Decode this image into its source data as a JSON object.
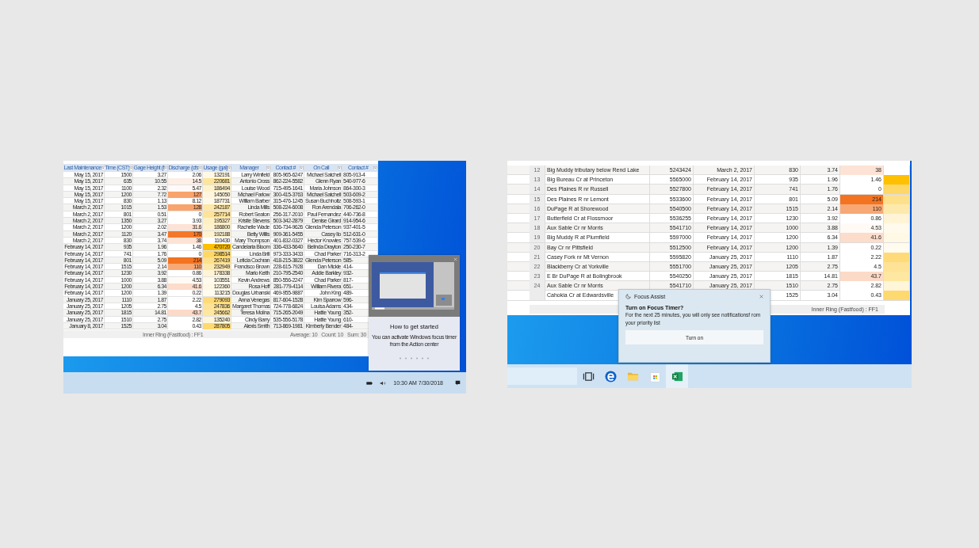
{
  "left_screen": {
    "left_table": {
      "columns": [
        "Last Maintenance",
        "Time (CST)",
        "Gage Height (f",
        "Discharge (cfs",
        "Usage (gal)",
        "Manager",
        "Contact #",
        "On Call",
        "Contact #"
      ],
      "rows": [
        {
          "date": "May 15, 2017",
          "time": "1500",
          "gage": "3.27",
          "discharge": {
            "text": "2.06",
            "color": "#ffffff"
          },
          "usage": {
            "text": "132191",
            "color": "#fff8e6"
          },
          "manager": "Larry Winfield",
          "contact": "805-965-6247",
          "on_call": "Michael Satchell",
          "contact_2": "805-913-4"
        },
        {
          "date": "May 15, 2017",
          "time": "635",
          "gage": "10.55",
          "discharge": {
            "text": "14.5",
            "color": "#fdeee6"
          },
          "usage": {
            "text": "220681",
            "color": "#fee59a"
          },
          "manager": "Antonio Cross",
          "contact": "862-224-5582",
          "on_call": "Glenn Ryan",
          "contact_2": "540-977-6"
        },
        {
          "date": "May 15, 2017",
          "time": "1100",
          "gage": "2.32",
          "discharge": {
            "text": "5.47",
            "color": "#fffaf7"
          },
          "usage": {
            "text": "186494",
            "color": "#fff2cc"
          },
          "manager": "Louise Wood",
          "contact": "715-495-1641",
          "on_call": "Maria Johnson",
          "contact_2": "864-300-3"
        },
        {
          "date": "May 15, 2017",
          "time": "1200",
          "gage": "7.72",
          "discharge": {
            "text": "127",
            "color": "#f8a46c"
          },
          "usage": {
            "text": "145050",
            "color": "#fff6dd"
          },
          "manager": "Michael Farlow",
          "contact": "300-415-3763",
          "on_call": "Michael Satchell",
          "contact_2": "503-609-2"
        },
        {
          "date": "May 15, 2017",
          "time": "830",
          "gage": "1.13",
          "discharge": {
            "text": "8.12",
            "color": "#ffffff"
          },
          "usage": {
            "text": "187731",
            "color": "#fff9ea"
          },
          "manager": "William Barber",
          "contact": "315-476-1245",
          "on_call": "Susan Buchholtz",
          "contact_2": "508-593-1"
        },
        {
          "date": "March 2, 2017",
          "time": "1015",
          "gage": "1.53",
          "discharge": {
            "text": "128",
            "color": "#f8a46c"
          },
          "usage": {
            "text": "242187",
            "color": "#fee8a6"
          },
          "manager": "Linda Mills",
          "contact": "508-224-6008",
          "on_call": "Ron Arendala",
          "contact_2": "706-262-0"
        },
        {
          "date": "March 2, 2017",
          "time": "801",
          "gage": "0.51",
          "discharge": {
            "text": "0",
            "color": "#ffffff"
          },
          "usage": {
            "text": "257714",
            "color": "#fee39a"
          },
          "manager": "Robert Seaton",
          "contact": "256-317-2010",
          "on_call": "Paul Fernandez",
          "contact_2": "440-736-8"
        },
        {
          "date": "March 2, 2017",
          "time": "1350",
          "gage": "3.27",
          "discharge": {
            "text": "3.93",
            "color": "#ffffff"
          },
          "usage": {
            "text": "195327",
            "color": "#fff0c4"
          },
          "manager": "Kristie Stevens",
          "contact": "503-342-2879",
          "on_call": "Denise Girard",
          "contact_2": "914-954-6"
        },
        {
          "date": "March 2, 2017",
          "time": "1200",
          "gage": "2.02",
          "discharge": {
            "text": "31.6",
            "color": "#fde3d5"
          },
          "usage": {
            "text": "186800",
            "color": "#fff2cc"
          },
          "manager": "Rachelle Wade",
          "contact": "636-734-9626",
          "on_call": "Glenda Peterson",
          "contact_2": "937-401-5"
        },
        {
          "date": "March 2, 2017",
          "time": "1120",
          "gage": "3.47",
          "discharge": {
            "text": "170",
            "color": "#f4782a"
          },
          "usage": {
            "text": "192188",
            "color": "#fff3d0"
          },
          "manager": "Betty Willis",
          "contact": "909-361-5455",
          "on_call": "Casey Ilo",
          "contact_2": "512-631-0"
        },
        {
          "date": "March 2, 2017",
          "time": "830",
          "gage": "3.74",
          "discharge": {
            "text": "38",
            "color": "#fde3d5"
          },
          "usage": {
            "text": "110430",
            "color": "#ffffff"
          },
          "manager": "Mary Thompson",
          "contact": "401-832-0327",
          "on_call": "Hector Knowles",
          "contact_2": "757-539-6"
        },
        {
          "date": "February 14, 2017",
          "time": "935",
          "gage": "1.96",
          "discharge": {
            "text": "1.46",
            "color": "#ffffff"
          },
          "usage": {
            "text": "470720",
            "color": "#fec000"
          },
          "manager": "Candelaria Bloom",
          "contact": "336-433-5640",
          "on_call": "Belinda Drayton",
          "contact_2": "250-230-7"
        },
        {
          "date": "February 14, 2017",
          "time": "741",
          "gage": "1.76",
          "discharge": {
            "text": "0",
            "color": "#ffffff"
          },
          "usage": {
            "text": "298514",
            "color": "#fed766"
          },
          "manager": "Linda Brill",
          "contact": "973-333-3433",
          "on_call": "Chad Parker",
          "contact_2": "716-313-2"
        },
        {
          "date": "February 14, 2017",
          "time": "801",
          "gage": "5.09",
          "discharge": {
            "text": "214",
            "color": "#f37320"
          },
          "usage": {
            "text": "267419",
            "color": "#fee08a"
          },
          "manager": "Leticia Cochran",
          "contact": "418-215-3822",
          "on_call": "Glenda Peterson",
          "contact_2": "585-"
        },
        {
          "date": "February 14, 2017",
          "time": "1515",
          "gage": "2.14",
          "discharge": {
            "text": "110",
            "color": "#f8a874"
          },
          "usage": {
            "text": "232949",
            "color": "#fee9ad"
          },
          "manager": "Francisco Brown",
          "contact": "228-615-7928",
          "on_call": "Dan Mickle",
          "contact_2": "414-"
        },
        {
          "date": "February 14, 2017",
          "time": "1230",
          "gage": "3.92",
          "discharge": {
            "text": "0.86",
            "color": "#ffffff"
          },
          "usage": {
            "text": "178338",
            "color": "#fff4d6"
          },
          "manager": "Mario Keith",
          "contact": "210-795-2540",
          "on_call": "Addie Barkley",
          "contact_2": "932-"
        },
        {
          "date": "February 14, 2017",
          "time": "1000",
          "gage": "3.88",
          "discharge": {
            "text": "4.53",
            "color": "#fffaf6"
          },
          "usage": {
            "text": "103551",
            "color": "#fffaeb"
          },
          "manager": "Kevin Andrews",
          "contact": "850-556-2247",
          "on_call": "Chad Parker",
          "contact_2": "817-"
        },
        {
          "date": "February 14, 2017",
          "time": "1200",
          "gage": "6.34",
          "discharge": {
            "text": "41.6",
            "color": "#fcdccb"
          },
          "usage": {
            "text": "122360",
            "color": "#fff8e5"
          },
          "manager": "Rosa Hoff",
          "contact": "281-779-4114",
          "on_call": "William Rivera",
          "contact_2": "651-"
        },
        {
          "date": "February 14, 2017",
          "time": "1200",
          "gage": "1.39",
          "discharge": {
            "text": "0.22",
            "color": "#ffffff"
          },
          "usage": {
            "text": "113215",
            "color": "#fffbee"
          },
          "manager": "Douglas Urbanski",
          "contact": "469-955-9887",
          "on_call": "John King",
          "contact_2": "489-"
        },
        {
          "date": "January 25, 2017",
          "time": "1110",
          "gage": "1.87",
          "discharge": {
            "text": "2.22",
            "color": "#ffffff"
          },
          "usage": {
            "text": "279093",
            "color": "#fedb78"
          },
          "manager": "Anna Venegas",
          "contact": "817-604-1528",
          "on_call": "Kim Sparrow",
          "contact_2": "596-"
        },
        {
          "date": "January 25, 2017",
          "time": "1205",
          "gage": "2.75",
          "discharge": {
            "text": "4.5",
            "color": "#ffffff"
          },
          "usage": {
            "text": "247836",
            "color": "#fee396"
          },
          "manager": "Margaret Thomas",
          "contact": "724-778-6824",
          "on_call": "Louisa Adams",
          "contact_2": "434-"
        },
        {
          "date": "January 25, 2017",
          "time": "1815",
          "gage": "14.81",
          "discharge": {
            "text": "43.7",
            "color": "#fcdac8"
          },
          "usage": {
            "text": "245662",
            "color": "#fee7a0"
          },
          "manager": "Teresa Molina",
          "contact": "715-265-2049",
          "on_call": "Hattie Young",
          "contact_2": "352-"
        },
        {
          "date": "January 25, 2017",
          "time": "1510",
          "gage": "2.75",
          "discharge": {
            "text": "2.82",
            "color": "#ffffff"
          },
          "usage": {
            "text": "135240",
            "color": "#fff5d8"
          },
          "manager": "Cindy Barry",
          "contact": "535-556-5178",
          "on_call": "Hattie Young",
          "contact_2": "610-"
        },
        {
          "date": "January 8, 2017",
          "time": "1525",
          "gage": "3.04",
          "discharge": {
            "text": "0.43",
            "color": "#ffffff"
          },
          "usage": {
            "text": "287805",
            "color": "#fed96f"
          },
          "manager": "Alexis Smith",
          "contact": "713-869-1981",
          "on_call": "Kimberly Bender",
          "contact_2": "484-"
        }
      ]
    },
    "status_bar": {
      "title": "Inner Ring (Fastfood) : FF1",
      "average": "Average: 10",
      "count": "Count: 10",
      "sum": "Sum: 30"
    },
    "tip_popup": {
      "title": "How to get started",
      "body": "You can activate Windows focus timer from the Action center"
    },
    "clock": "10:30 AM 7/30/2018"
  },
  "right_screen": {
    "right_table": {
      "rows": [
        {
          "number": "12",
          "name": "Big Muddy tributary below Rend Lake",
          "site": "5243424",
          "date": "March 2, 2017",
          "time": "830",
          "gage": "3.74",
          "discharge": {
            "text": "38",
            "color": "#fde3d5"
          },
          "usage": {
            "color": "#ffffff"
          }
        },
        {
          "number": "13",
          "name": "Big Bureau Cr at Princeton",
          "site": "5565000",
          "date": "February 14, 2017",
          "time": "935",
          "gage": "1.96",
          "discharge": {
            "text": "1.46",
            "color": "#ffffff"
          },
          "usage": {
            "color": "#fec000"
          }
        },
        {
          "number": "14",
          "name": "Des Plaines R nr Russell",
          "site": "5527800",
          "date": "February 14, 2017",
          "time": "741",
          "gage": "1.76",
          "discharge": {
            "text": "0",
            "color": "#ffffff"
          },
          "usage": {
            "color": "#fed766"
          }
        },
        {
          "number": "15",
          "name": "Des Plaines R nr Lemont",
          "site": "5533600",
          "date": "February 14, 2017",
          "time": "801",
          "gage": "5.09",
          "discharge": {
            "text": "214",
            "color": "#f37320"
          },
          "usage": {
            "color": "#fee08a"
          }
        },
        {
          "number": "16",
          "name": "DuPage R at Shorewood",
          "site": "5540500",
          "date": "February 14, 2017",
          "time": "1515",
          "gage": "2.14",
          "discharge": {
            "text": "110",
            "color": "#f8a874"
          },
          "usage": {
            "color": "#fee9ad"
          }
        },
        {
          "number": "17",
          "name": "Butterfield Cr at Flossmoor",
          "site": "5536255",
          "date": "February 14, 2017",
          "time": "1230",
          "gage": "3.92",
          "discharge": {
            "text": "0.86",
            "color": "#ffffff"
          },
          "usage": {
            "color": "#fff4d6"
          }
        },
        {
          "number": "18",
          "name": "Aux Sable Cr nr Morris",
          "site": "5541710",
          "date": "February 14, 2017",
          "time": "1000",
          "gage": "3.88",
          "discharge": {
            "text": "4.53",
            "color": "#fffaf6"
          },
          "usage": {
            "color": "#fffaeb"
          }
        },
        {
          "number": "19",
          "name": "Big Muddy R at Plumfield",
          "site": "5597000",
          "date": "February 14, 2017",
          "time": "1200",
          "gage": "6.34",
          "discharge": {
            "text": "41.6",
            "color": "#fcdccb"
          },
          "usage": {
            "color": "#fff8e5"
          }
        },
        {
          "number": "20",
          "name": "Bay Cr nr Pittsfield",
          "site": "5512500",
          "date": "February 14, 2017",
          "time": "1200",
          "gage": "1.39",
          "discharge": {
            "text": "0.22",
            "color": "#ffffff"
          },
          "usage": {
            "color": "#fffbee"
          }
        },
        {
          "number": "21",
          "name": "Casey Fork nr Mt Vernon",
          "site": "5595820",
          "date": "January 25, 2017",
          "time": "1110",
          "gage": "1.87",
          "discharge": {
            "text": "2.22",
            "color": "#ffffff"
          },
          "usage": {
            "color": "#fedb78"
          }
        },
        {
          "number": "22",
          "name": "Blackberry Cr at Yorkville",
          "site": "5551700",
          "date": "January 25, 2017",
          "time": "1205",
          "gage": "2.75",
          "discharge": {
            "text": "4.5",
            "color": "#ffffff"
          },
          "usage": {
            "color": "#fee396"
          }
        },
        {
          "number": "23",
          "name": "E Br DuPage R at Bolingbrook",
          "site": "5540250",
          "date": "January 25, 2017",
          "time": "1815",
          "gage": "14.81",
          "discharge": {
            "text": "43.7",
            "color": "#fcdac8"
          },
          "usage": {
            "color": "#fee7a0"
          }
        },
        {
          "number": "24",
          "name": "Aux Sable Cr nr Morris",
          "site": "5541710",
          "date": "January 25, 2017",
          "time": "1510",
          "gage": "2.75",
          "discharge": {
            "text": "2.82",
            "color": "#ffffff"
          },
          "usage": {
            "color": "#fff5d8"
          }
        },
        {
          "name": "Cahokia Cr at Edwardsville",
          "time": "1525",
          "gage": "3.04",
          "discharge": {
            "text": "0.43",
            "color": "#ffffff"
          },
          "usage": {
            "color": "#fed96f"
          }
        }
      ]
    },
    "status_bar": {
      "title": "Inner Ring (Fastfood) : FF1"
    },
    "focus_popup": {
      "app": "Focus Assist",
      "title": "Turn on Focus Timer?",
      "body": "For the next 25 minutes, you will only see notificationsf rom your priority list",
      "button": "Turn on"
    },
    "taskbar": [
      {
        "kind": "taskview",
        "selected": false
      },
      {
        "kind": "edge",
        "selected": false
      },
      {
        "kind": "folder",
        "selected": false
      },
      {
        "kind": "store",
        "selected": false
      },
      {
        "kind": "excel",
        "selected": true
      }
    ]
  }
}
